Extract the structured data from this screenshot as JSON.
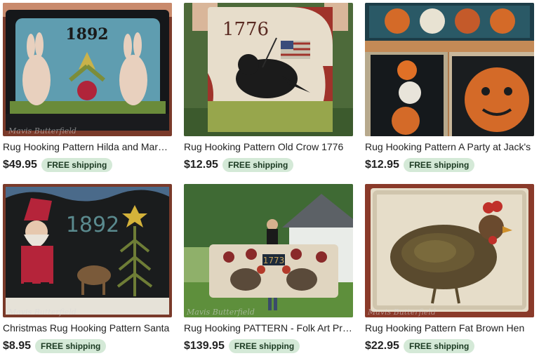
{
  "listings": [
    {
      "title": "Rug Hooking Pattern Hilda and Margaret",
      "price": "$49.95",
      "shipping": "FREE shipping",
      "image_text": "1892",
      "watermark": "Mavis Butterfield"
    },
    {
      "title": "Rug Hooking Pattern Old Crow 1776",
      "price": "$12.95",
      "shipping": "FREE shipping",
      "image_text": "1776"
    },
    {
      "title": "Rug Hooking Pattern A Party at Jack's",
      "price": "$12.95",
      "shipping": "FREE shipping"
    },
    {
      "title": "Christmas Rug Hooking Pattern Santa",
      "price": "$8.95",
      "shipping": "FREE shipping",
      "image_text": "1892",
      "watermark": "Mavis Butterfield"
    },
    {
      "title": "Rug Hooking PATTERN - Folk Art Primitive",
      "price": "$139.95",
      "shipping": "FREE shipping",
      "image_text": "1773",
      "watermark": "Mavis Butterfield"
    },
    {
      "title": "Rug Hooking Pattern Fat Brown Hen",
      "price": "$22.95",
      "shipping": "FREE shipping",
      "watermark": "Mavis Butterfield"
    }
  ],
  "colors": {
    "shipping_badge": "#d4e9d7",
    "price": "#222222"
  }
}
